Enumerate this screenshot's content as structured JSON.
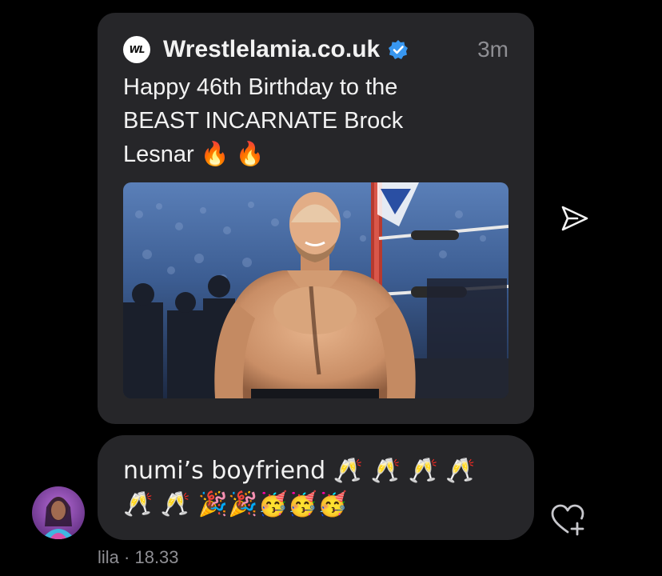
{
  "post": {
    "logo_text": "WL",
    "site_name": "Wrestlelamia.co.uk",
    "time": "3m",
    "caption": "Happy 46th Birthday to the BEAST INCARNATE Brock Lesnar 🔥 🔥",
    "image_icon": "photo-of-shirtless-wrestler-in-arena"
  },
  "message": {
    "text": "numi’s boyfriend 🥂 🥂 🥂 🥂 🥂 🥂 🎉🎉🥳🥳🥳",
    "sender": "lila",
    "time": "· 18.33"
  },
  "icons": {
    "share": "send-icon",
    "like": "heart-add-icon",
    "verified": "verified-badge-icon"
  },
  "colors": {
    "background": "#000000",
    "bubble": "#262629",
    "text": "#f2f2f2",
    "muted": "#8e8e93",
    "verified": "#3897f0"
  }
}
